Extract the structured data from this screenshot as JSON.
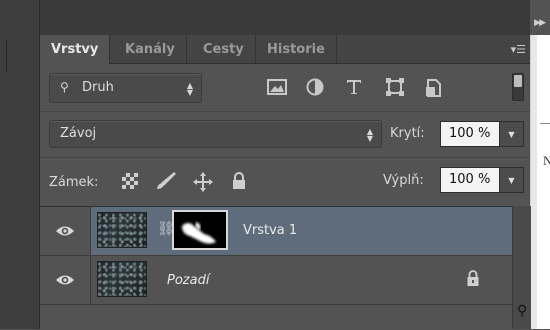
{
  "tabs": [
    {
      "label": "Vrstvy",
      "active": true
    },
    {
      "label": "Kanály",
      "active": false
    },
    {
      "label": "Cesty",
      "active": false
    },
    {
      "label": "Historie",
      "active": false
    }
  ],
  "filter": {
    "label": "Druh",
    "icons": [
      "image-filter-icon",
      "adjustment-filter-icon",
      "type-filter-icon",
      "shape-filter-icon",
      "smart-object-filter-icon"
    ]
  },
  "blend": {
    "mode": "Závoj",
    "opacity_label": "Krytí:",
    "opacity_value": "100 %"
  },
  "lock": {
    "label": "Zámek:",
    "fill_label": "Výplň:",
    "fill_value": "100 %"
  },
  "layers": [
    {
      "name": "Vrstva 1",
      "selected": true,
      "visible": true,
      "has_mask": true,
      "locked": false
    },
    {
      "name": "Pozadí",
      "selected": false,
      "visible": true,
      "has_mask": false,
      "locked": true
    }
  ],
  "right_letter": "N",
  "colors": {
    "panel": "#535353",
    "selected_row": "#5e6c7b",
    "tab_bar": "#444444"
  }
}
